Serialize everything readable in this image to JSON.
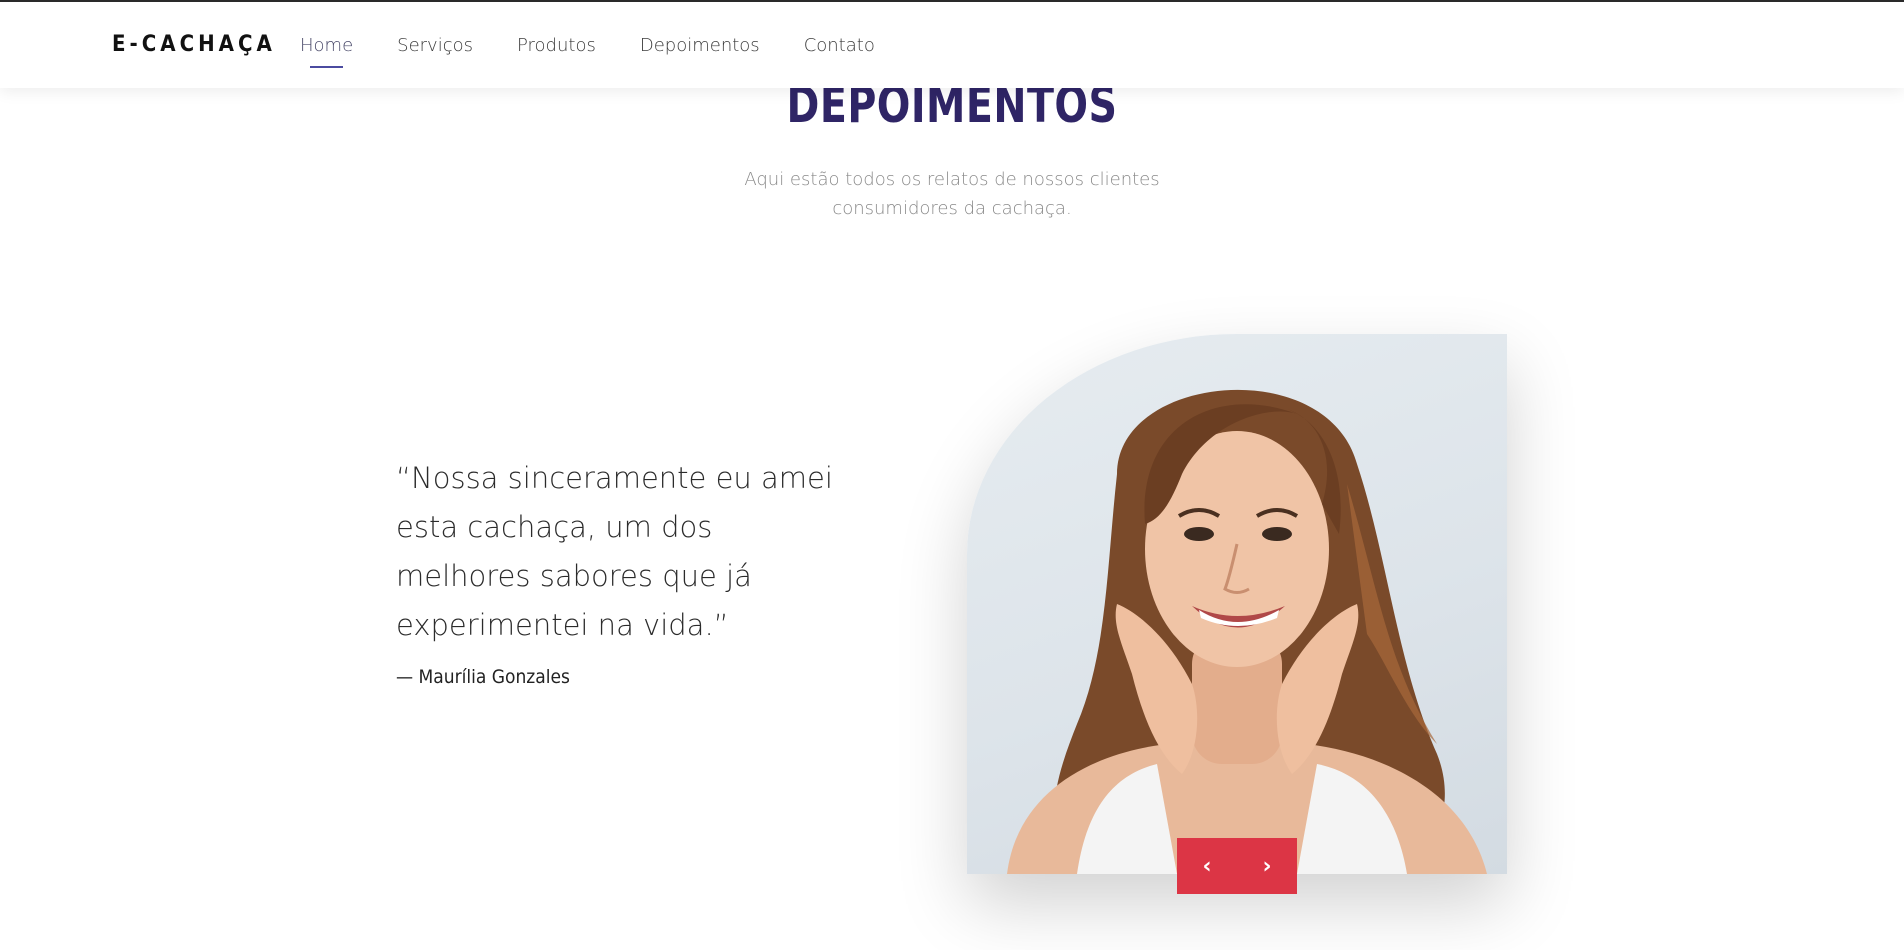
{
  "navbar": {
    "brand": "E-CACHAÇA",
    "items": [
      {
        "label": "Home",
        "active": true
      },
      {
        "label": "Serviços",
        "active": false
      },
      {
        "label": "Produtos",
        "active": false
      },
      {
        "label": "Depoimentos",
        "active": false
      },
      {
        "label": "Contato",
        "active": false
      }
    ]
  },
  "section": {
    "title": "DEPOIMENTOS",
    "subtitle": "Aqui estão todos os relatos de nossos clientes consumidores da cachaça."
  },
  "testimonial": {
    "quote": "“Nossa sinceramente eu amei esta cachaça, um dos melhores sabores que já experimentei na vida.”",
    "author": "— Maurília Gonzales",
    "photo_icon": "smiling-woman-portrait"
  },
  "slider": {
    "prev_icon": "chevron-left-icon",
    "next_icon": "chevron-right-icon",
    "prev_glyph": "‹",
    "next_glyph": "›"
  },
  "colors": {
    "accent": "#dc3545",
    "title": "#2f2566",
    "nav_underline": "#4b4ba0"
  }
}
